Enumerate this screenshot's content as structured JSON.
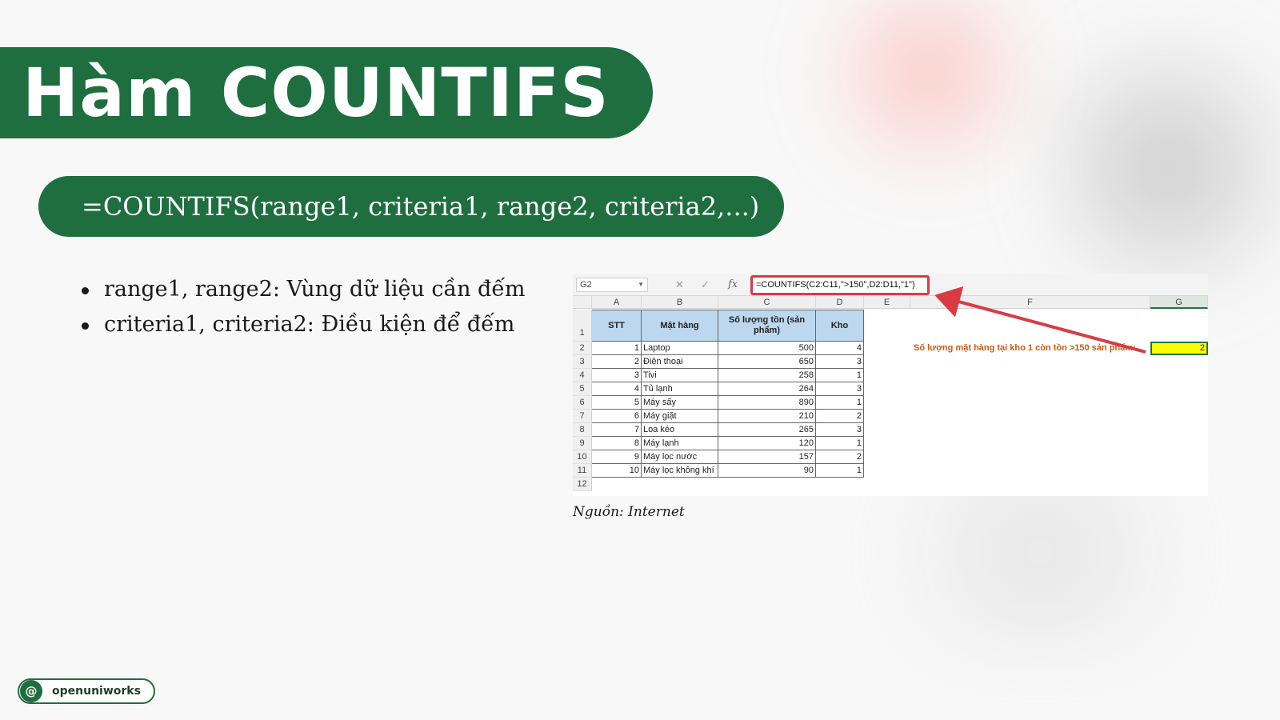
{
  "slide": {
    "title": "Hàm COUNTIFS",
    "syntax": "=COUNTIFS(range1, criteria1, range2, criteria2,...)",
    "bullets": [
      "range1, range2: Vùng dữ liệu cần đếm",
      "criteria1, criteria2: Điều kiện để đếm"
    ],
    "caption": "Nguồn: Internet",
    "logo_text": "openuniworks",
    "logo_icon": "at-icon",
    "colors": {
      "brand_green": "#1f6e40",
      "arrow_red": "#d93b44",
      "table_header": "#bdd7ee",
      "result_fill": "#ffff00"
    }
  },
  "excel": {
    "name_box": "G2",
    "formula": "=COUNTIFS(C2:C11,\">150\",D2:D11,\"1\")",
    "columns": [
      "A",
      "B",
      "C",
      "D",
      "E",
      "F",
      "G"
    ],
    "rows": [
      "1",
      "2",
      "3",
      "4",
      "5",
      "6",
      "7",
      "8",
      "9",
      "10",
      "11",
      "12"
    ],
    "table_headers": {
      "stt": "STT",
      "item": "Mặt hàng",
      "qty": "Số lượng tồn (sản phẩm)",
      "warehouse": "Kho"
    },
    "table_rows": [
      {
        "stt": "1",
        "item": "Laptop",
        "qty": "500",
        "kho": "4"
      },
      {
        "stt": "2",
        "item": "Điện thoại",
        "qty": "650",
        "kho": "3"
      },
      {
        "stt": "3",
        "item": "Tivi",
        "qty": "258",
        "kho": "1"
      },
      {
        "stt": "4",
        "item": "Tủ lạnh",
        "qty": "264",
        "kho": "3"
      },
      {
        "stt": "5",
        "item": "Máy sấy",
        "qty": "890",
        "kho": "1"
      },
      {
        "stt": "6",
        "item": "Máy giặt",
        "qty": "210",
        "kho": "2"
      },
      {
        "stt": "7",
        "item": "Loa kéo",
        "qty": "265",
        "kho": "3"
      },
      {
        "stt": "8",
        "item": "Máy lạnh",
        "qty": "120",
        "kho": "1"
      },
      {
        "stt": "9",
        "item": "Máy lọc nước",
        "qty": "157",
        "kho": "2"
      },
      {
        "stt": "10",
        "item": "Máy lọc không khí",
        "qty": "90",
        "kho": "1"
      }
    ],
    "note_label": "Số lượng mặt hàng tại kho 1 còn tồn >150 sản phẩm:",
    "result": "2"
  }
}
